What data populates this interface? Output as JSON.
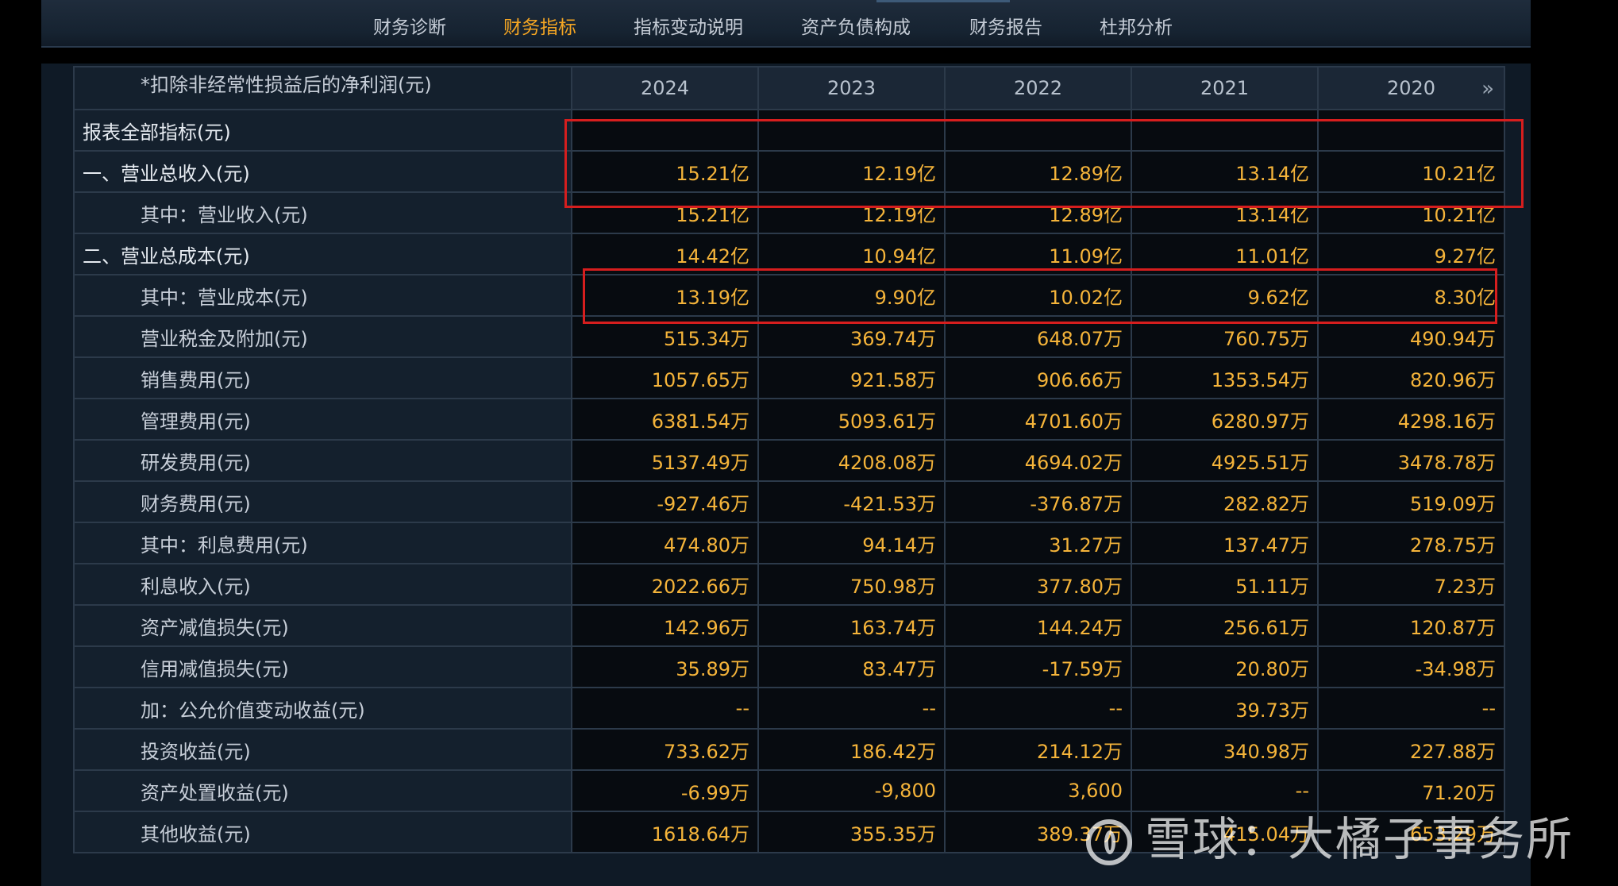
{
  "nav": [
    "财务诊断",
    "财务指标",
    "指标变动说明",
    "资产负债构成",
    "财务报告",
    "杜邦分析"
  ],
  "header": {
    "label": "*扣除非经常性损益后的净利润(元)",
    "years": [
      "2024",
      "2023",
      "2022",
      "2021",
      "2020"
    ],
    "more_icon": "double-chevron-right-icon"
  },
  "rows": [
    {
      "label": "报表全部指标(元)",
      "values": [
        "",
        "",
        "",
        "",
        ""
      ]
    },
    {
      "label": "一、营业总收入(元)",
      "values": [
        "15.21亿",
        "12.19亿",
        "12.89亿",
        "13.14亿",
        "10.21亿"
      ]
    },
    {
      "label": "其中：营业收入(元)",
      "values": [
        "15.21亿",
        "12.19亿",
        "12.89亿",
        "13.14亿",
        "10.21亿"
      ]
    },
    {
      "label": "二、营业总成本(元)",
      "values": [
        "14.42亿",
        "10.94亿",
        "11.09亿",
        "11.01亿",
        "9.27亿"
      ]
    },
    {
      "label": "其中：营业成本(元)",
      "values": [
        "13.19亿",
        "9.90亿",
        "10.02亿",
        "9.62亿",
        "8.30亿"
      ]
    },
    {
      "label": "营业税金及附加(元)",
      "values": [
        "515.34万",
        "369.74万",
        "648.07万",
        "760.75万",
        "490.94万"
      ]
    },
    {
      "label": "销售费用(元)",
      "values": [
        "1057.65万",
        "921.58万",
        "906.66万",
        "1353.54万",
        "820.96万"
      ]
    },
    {
      "label": "管理费用(元)",
      "values": [
        "6381.54万",
        "5093.61万",
        "4701.60万",
        "6280.97万",
        "4298.16万"
      ]
    },
    {
      "label": "研发费用(元)",
      "values": [
        "5137.49万",
        "4208.08万",
        "4694.02万",
        "4925.51万",
        "3478.78万"
      ]
    },
    {
      "label": "财务费用(元)",
      "values": [
        "-927.46万",
        "-421.53万",
        "-376.87万",
        "282.82万",
        "519.09万"
      ]
    },
    {
      "label": "其中：利息费用(元)",
      "values": [
        "474.80万",
        "94.14万",
        "31.27万",
        "137.47万",
        "278.75万"
      ]
    },
    {
      "label": "利息收入(元)",
      "values": [
        "2022.66万",
        "750.98万",
        "377.80万",
        "51.11万",
        "7.23万"
      ]
    },
    {
      "label": "资产减值损失(元)",
      "values": [
        "142.96万",
        "163.74万",
        "144.24万",
        "256.61万",
        "120.87万"
      ]
    },
    {
      "label": "信用减值损失(元)",
      "values": [
        "35.89万",
        "83.47万",
        "-17.59万",
        "20.80万",
        "-34.98万"
      ]
    },
    {
      "label": "加：公允价值变动收益(元)",
      "values": [
        "--",
        "--",
        "--",
        "39.73万",
        "--"
      ]
    },
    {
      "label": "投资收益(元)",
      "values": [
        "733.62万",
        "186.42万",
        "214.12万",
        "340.98万",
        "227.88万"
      ]
    },
    {
      "label": "资产处置收益(元)",
      "values": [
        "-6.99万",
        "-9,800",
        "3,600",
        "--",
        "71.20万"
      ]
    },
    {
      "label": "其他收益(元)",
      "values": [
        "1618.64万",
        "355.35万",
        "389.37万",
        "415.04万",
        "653.29万"
      ]
    }
  ],
  "watermark": "雪球：大橘子事务所",
  "colors": {
    "value": "#f5b43a",
    "active_nav": "#f5a623",
    "highlight_box": "#d61e1e"
  }
}
